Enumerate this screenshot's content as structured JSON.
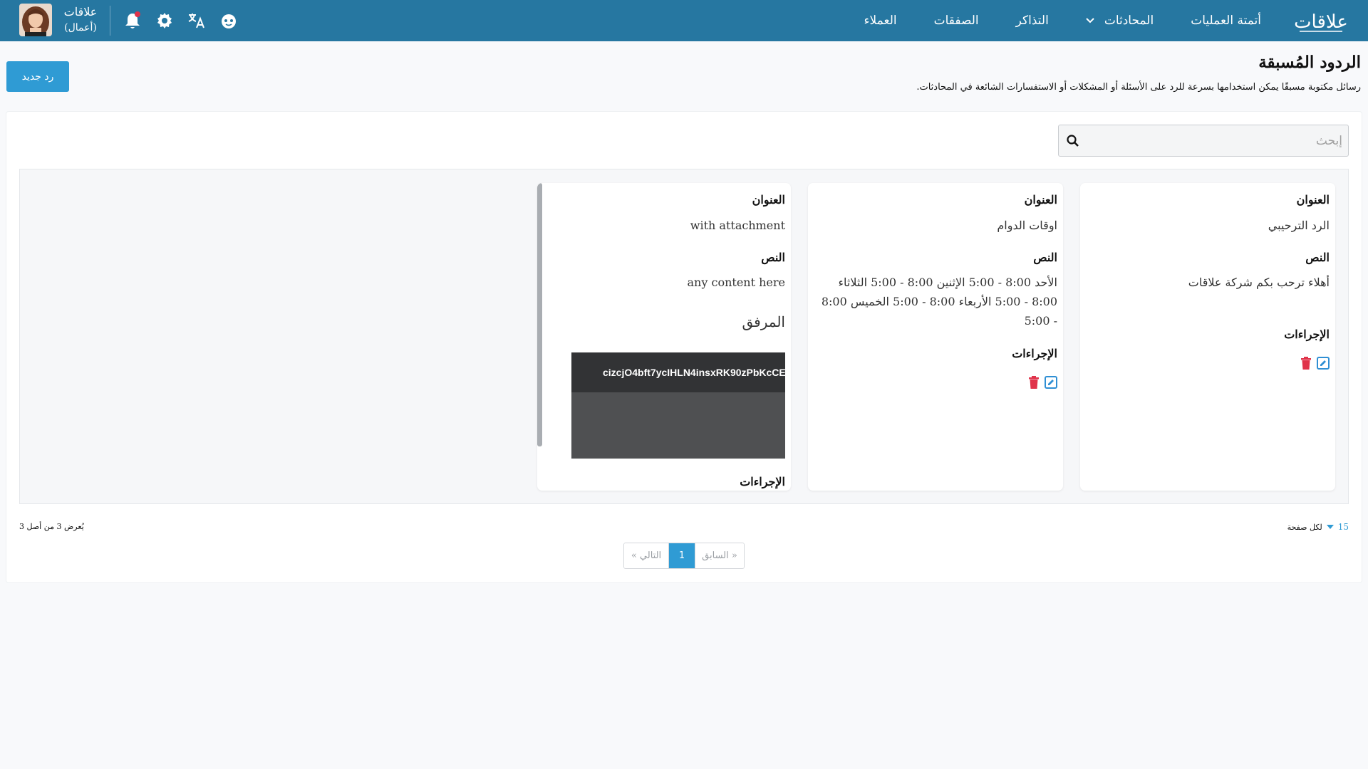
{
  "navbar": {
    "brand": "علاقات",
    "links": [
      {
        "label": "العملاء"
      },
      {
        "label": "الصفقات"
      },
      {
        "label": "التذاكر"
      },
      {
        "label": "المحادثات",
        "has_dropdown": true
      },
      {
        "label": "أتمتة العمليات"
      }
    ],
    "user": {
      "name": "علاقات",
      "subtitle": "(أعمال)"
    },
    "icons": [
      "notifications-bell-icon",
      "settings-gear-icon",
      "translate-icon",
      "support-bot-icon"
    ],
    "brand_color": "#2677a1"
  },
  "header": {
    "title": "الردود المُسبقة",
    "description": "رسائل مكتوبة مسبقًا يمكن استخدامها بسرعة للرد على الأسئلة أو المشكلات أو الاستفسارات الشائعة في المحادثات.",
    "new_button": "رد جديد"
  },
  "search": {
    "placeholder": "إبحث"
  },
  "labels": {
    "title": "العنوان",
    "content": "النص",
    "attachment": "المرفق",
    "actions": "الإجراءات"
  },
  "cards": [
    {
      "title": "الرد الترحيبي",
      "content": "أهلاء ترحب بكم شركة علاقات"
    },
    {
      "title": "اوقات الدوام",
      "content": "الأحد 8:00 - 5:00 الإثنين 8:00 - 5:00 الثلاثاء 8:00 - 5:00 الأربعاء 8:00 - 5:00 الخميس 8:00 - 5:00"
    },
    {
      "title": "with attachment",
      "content": "any content here",
      "attachment_name": "cizcjO4bft7ycIHLN4insxRK90zPbKcCE"
    }
  ],
  "pagination": {
    "per_page_value": "15",
    "per_page_label": "لكل صفحة",
    "showing": "يُعرض 3 من أصل 3",
    "prev": "« السابق",
    "current": "1",
    "next": "التالي »"
  },
  "colors": {
    "accent": "#2f9bd4",
    "delete": "#e0334a",
    "edit": "#2f8fd4"
  }
}
